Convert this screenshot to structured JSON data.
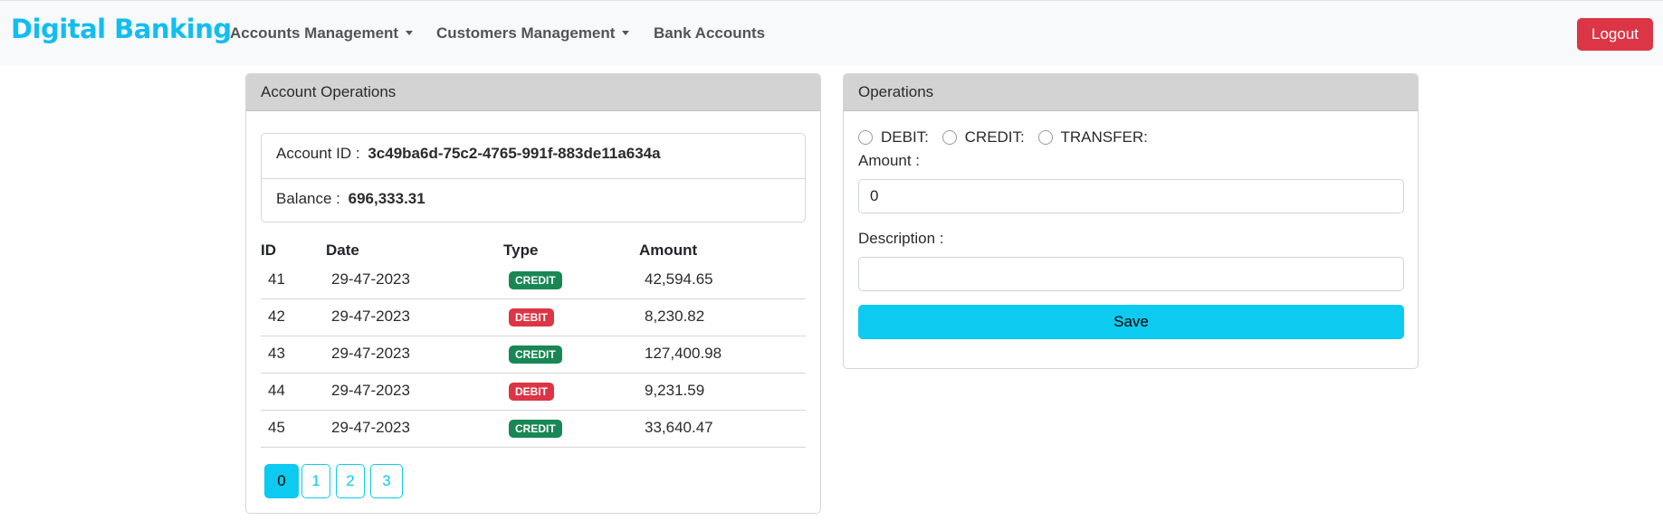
{
  "navbar": {
    "brand": "Digital Banking",
    "items": [
      {
        "label": "Accounts Management",
        "dropdown": true
      },
      {
        "label": "Customers Management",
        "dropdown": true
      },
      {
        "label": "Bank Accounts",
        "dropdown": false
      }
    ],
    "logout_label": "Logout"
  },
  "account_card": {
    "title": "Account Operations",
    "account_id_label": "Account ID :",
    "account_id": "3c49ba6d-75c2-4765-991f-883de11a634a",
    "balance_label": "Balance :",
    "balance": "696,333.31",
    "table": {
      "headers": [
        "ID",
        "Date",
        "Type",
        "Amount"
      ],
      "rows": [
        {
          "id": "41",
          "date": "29-47-2023",
          "type": "CREDIT",
          "amount": "42,594.65"
        },
        {
          "id": "42",
          "date": "29-47-2023",
          "type": "DEBIT",
          "amount": "8,230.82"
        },
        {
          "id": "43",
          "date": "29-47-2023",
          "type": "CREDIT",
          "amount": "127,400.98"
        },
        {
          "id": "44",
          "date": "29-47-2023",
          "type": "DEBIT",
          "amount": "9,231.59"
        },
        {
          "id": "45",
          "date": "29-47-2023",
          "type": "CREDIT",
          "amount": "33,640.47"
        }
      ]
    },
    "pagination": {
      "pages": [
        "0",
        "1",
        "2",
        "3"
      ],
      "current": "0"
    }
  },
  "operations_card": {
    "title": "Operations",
    "radio_options": [
      "DEBIT:",
      "CREDIT:",
      "TRANSFER:"
    ],
    "amount_label": "Amount :",
    "amount_value": "0",
    "description_label": "Description :",
    "description_value": "",
    "save_label": "Save"
  },
  "colors": {
    "brand": "#12bdf0",
    "logout": "#dc3545",
    "credit_badge": "#198754",
    "debit_badge": "#dc3545",
    "accent": "#0dcaf0"
  }
}
